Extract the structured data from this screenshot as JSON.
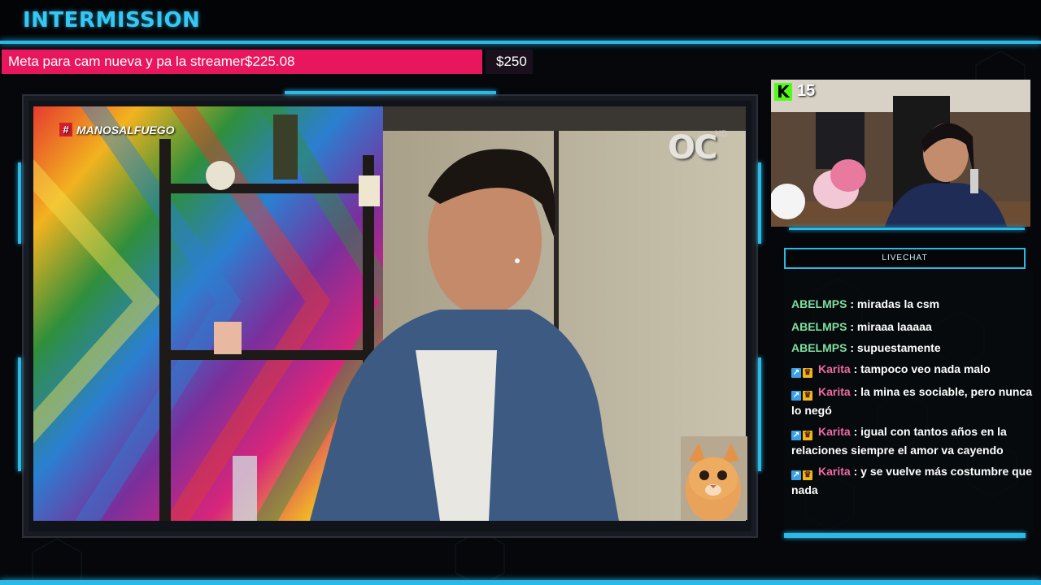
{
  "header": {
    "title": "INTERMISSION"
  },
  "goal": {
    "label": "Meta para cam nueva y pa la streamer$225.08",
    "target": "$250",
    "progress_fraction": 0.9,
    "color": "#e8175d"
  },
  "main_video": {
    "hashtag": "MANOSALFUEGO",
    "hash_symbol": "#",
    "channel_logo": "OC",
    "channel_hd": "HD"
  },
  "webcam": {
    "platform_icon": "kick-icon",
    "platform_letter": "K",
    "viewer_count": "15"
  },
  "chat": {
    "header": "LIVECHAT",
    "messages": [
      {
        "user": "ABELMPS",
        "sep": " : ",
        "text": "miradas la csm",
        "color": "#7ee0a0",
        "badges": false,
        "partial": true
      },
      {
        "user": "ABELMPS",
        "sep": " : ",
        "text": "miraaa laaaaa",
        "color": "#7ee0a0",
        "badges": false
      },
      {
        "user": "ABELMPS",
        "sep": " : ",
        "text": "supuestamente",
        "color": "#7ee0a0",
        "badges": false
      },
      {
        "user": "Karita",
        "sep": " : ",
        "text": "tampoco veo nada malo",
        "color": "#f06aa5",
        "badges": true
      },
      {
        "user": "Karita",
        "sep": " : ",
        "text": "la mina es sociable, pero nunca lo negó",
        "color": "#f06aa5",
        "badges": true
      },
      {
        "user": "Karita",
        "sep": " : ",
        "text": "igual con tantos años en la relaciones siempre el amor va cayendo",
        "color": "#f06aa5",
        "badges": true
      },
      {
        "user": "Karita",
        "sep": " : ",
        "text": "y se vuelve más costumbre que nada",
        "color": "#f06aa5",
        "badges": true
      }
    ]
  },
  "colors": {
    "accent": "#2cb9e8",
    "title": "#36c8f5",
    "kick_green": "#53fc18"
  }
}
